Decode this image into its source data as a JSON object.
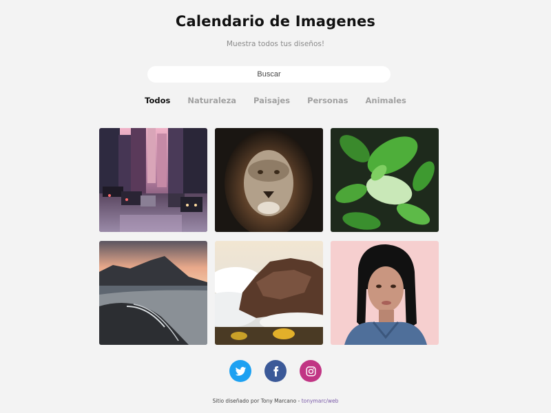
{
  "header": {
    "title": "Calendario de Imagenes",
    "subtitle": "Muestra todos tus diseños!"
  },
  "search": {
    "placeholder": "Buscar"
  },
  "filters": [
    {
      "label": "Todos",
      "active": true
    },
    {
      "label": "Naturaleza",
      "active": false
    },
    {
      "label": "Paisajes",
      "active": false
    },
    {
      "label": "Personas",
      "active": false
    },
    {
      "label": "Animales",
      "active": false
    }
  ],
  "gallery": [
    {
      "subject": "city-street-traffic"
    },
    {
      "subject": "lion-portrait"
    },
    {
      "subject": "green-leaves"
    },
    {
      "subject": "mountain-beach-sunset"
    },
    {
      "subject": "cliff-above-clouds"
    },
    {
      "subject": "woman-portrait"
    }
  ],
  "social": [
    {
      "name": "twitter-icon",
      "color": "#1da1f2"
    },
    {
      "name": "facebook-icon",
      "color": "#3b5998"
    },
    {
      "name": "instagram-icon",
      "color": "#c13584"
    }
  ],
  "footer": {
    "text": "Sitio diseñado por Tony Marcano - ",
    "link": "tonymarc/web"
  }
}
